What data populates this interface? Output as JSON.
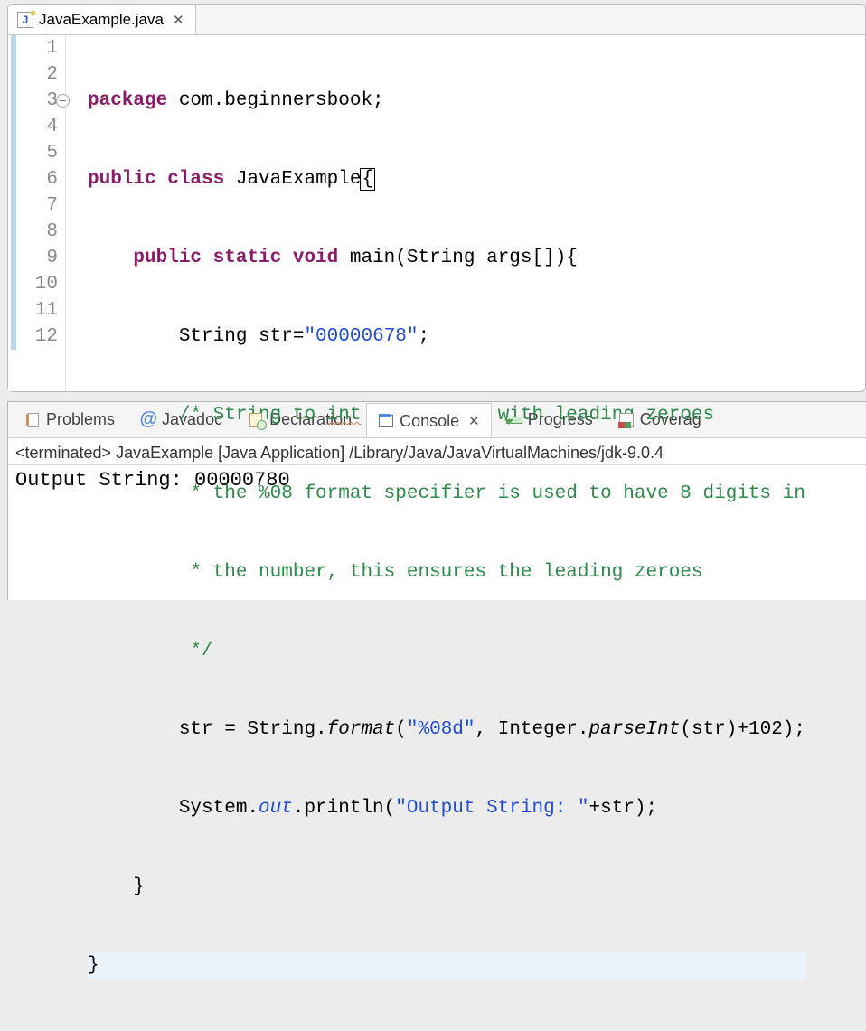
{
  "editor": {
    "tab_name": "JavaExample.java",
    "lines": {
      "l1a": "package",
      "l1b": " com.beginnersbook;",
      "l2a": "public",
      "l2b": " class",
      "l2c": " JavaExample",
      "l3a": "    public",
      "l3b": " static",
      "l3c": " void",
      "l3d": " main(String args[]){",
      "l4a": "        String str=",
      "l4b": "\"00000678\"",
      "l4c": ";",
      "l5a": "        /* String to ",
      "l5int": "int",
      "l5b": " conversion with leading zeroes",
      "l6": "         * the %08 format specifier is used to have 8 digits in",
      "l7": "         * the number, this ensures the leading zeroes",
      "l8": "         */",
      "l9a": "        str = String.",
      "l9b": "format",
      "l9c": "(",
      "l9d": "\"%08d\"",
      "l9e": ", Integer.",
      "l9f": "parseInt",
      "l9g": "(str)+102);",
      "l10a": "        System.",
      "l10b": "out",
      "l10c": ".println(",
      "l10d": "\"Output String: \"",
      "l10e": "+str);",
      "l11": "    }",
      "l12": "}"
    },
    "line_numbers": [
      "1",
      "2",
      "3",
      "4",
      "5",
      "6",
      "7",
      "8",
      "9",
      "10",
      "11",
      "12"
    ]
  },
  "views": {
    "problems": "Problems",
    "javadoc": "Javadoc",
    "declaration": "Declaration",
    "console": "Console",
    "progress": "Progress",
    "coverage": "Coverag"
  },
  "console": {
    "status_line": "<terminated> JavaExample [Java Application] /Library/Java/JavaVirtualMachines/jdk-9.0.4",
    "output_line": "Output String: 00000780"
  }
}
